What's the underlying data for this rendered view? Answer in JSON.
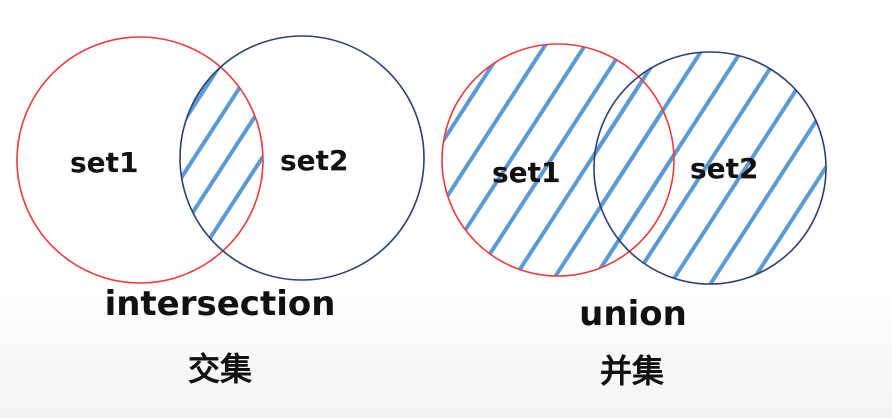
{
  "colors": {
    "circle_set1": "#ee3b3b",
    "circle_set2": "#2b3f7a",
    "hatch": "#5b9bd5"
  },
  "intersection_diagram": {
    "set1_label": "set1",
    "set2_label": "set2",
    "caption": "intersection",
    "caption_cn": "交集",
    "shaded_region": "intersection"
  },
  "union_diagram": {
    "set1_label": "set1",
    "set2_label": "set2",
    "caption": "union",
    "caption_cn": "并集",
    "shaded_region": "union"
  }
}
